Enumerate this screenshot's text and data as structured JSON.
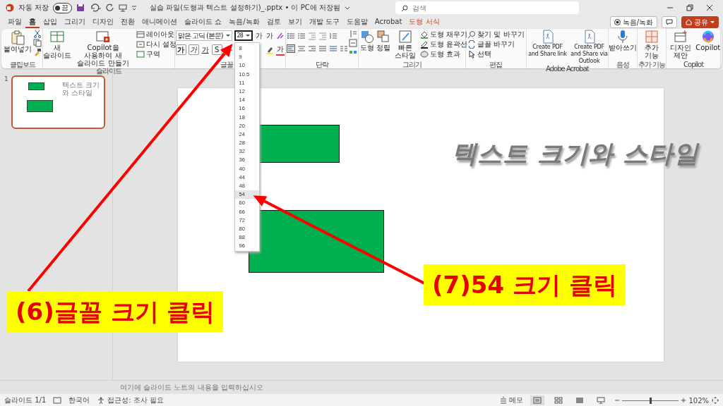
{
  "title_bar": {
    "autosave_label": "자동 저장",
    "autosave_toggle": {
      "label": "끔",
      "on": false
    },
    "document_title": "실습 파일(도형과 텍스트 설정하기)_.pptx • 이 PC에 저장됨",
    "search": {
      "placeholder": "검색"
    }
  },
  "tabs": [
    {
      "label": "파일",
      "kind": "normal",
      "selected": false
    },
    {
      "label": "홈",
      "kind": "normal",
      "selected": true
    },
    {
      "label": "삽입",
      "kind": "normal",
      "selected": false
    },
    {
      "label": "그리기",
      "kind": "normal",
      "selected": false
    },
    {
      "label": "디자인",
      "kind": "normal",
      "selected": false
    },
    {
      "label": "전환",
      "kind": "normal",
      "selected": false
    },
    {
      "label": "애니메이션",
      "kind": "normal",
      "selected": false
    },
    {
      "label": "슬라이드 쇼",
      "kind": "normal",
      "selected": false
    },
    {
      "label": "녹음/녹화",
      "kind": "normal",
      "selected": false
    },
    {
      "label": "검토",
      "kind": "normal",
      "selected": false
    },
    {
      "label": "보기",
      "kind": "normal",
      "selected": false
    },
    {
      "label": "개발 도구",
      "kind": "normal",
      "selected": false
    },
    {
      "label": "도움말",
      "kind": "normal",
      "selected": false
    },
    {
      "label": "Acrobat",
      "kind": "normal",
      "selected": false
    },
    {
      "label": "도형 서식",
      "kind": "contextual",
      "selected": false
    }
  ],
  "header_buttons": [
    {
      "kind": "record",
      "label": "녹음/녹화"
    },
    {
      "kind": "comment"
    },
    {
      "kind": "share",
      "label": "공유"
    }
  ],
  "ribbon": {
    "groups": [
      {
        "kind": "clipboard",
        "label": "클립보드",
        "paste": "붙여넣기"
      },
      {
        "kind": "slides",
        "label": "슬라이드",
        "large": [
          "새 슬라이드",
          "Copilot을 사용하여 새 슬라이드 만들기"
        ],
        "small": [
          "레이아웃",
          "다시 설정",
          "구역"
        ]
      },
      {
        "kind": "font",
        "label": "글꼴",
        "font_name": "맑은 고딕 (본문)",
        "font_size": "28",
        "grow": "가",
        "shrink": "가",
        "bold": "가",
        "italic": "가",
        "underline": "가",
        "shadow": "S",
        "font_color": "가"
      },
      {
        "kind": "paragraph",
        "label": "단락"
      },
      {
        "kind": "drawing",
        "label": "그리기",
        "large": [
          "도형",
          "정렬",
          "빠른 스타일"
        ],
        "small": [
          "도형 채우기",
          "도형 윤곽선",
          "도형 효과"
        ]
      },
      {
        "kind": "editing",
        "label": "편집",
        "small": [
          "찾기 및 바꾸기",
          "글꼴 바꾸기",
          "선택"
        ]
      },
      {
        "kind": "acrobat",
        "label": "Adobe Acrobat",
        "large": [
          "Create PDF and Share link",
          "Create PDF and Share via Outlook"
        ]
      },
      {
        "kind": "voice",
        "label": "음성",
        "large": [
          "받아쓰기"
        ]
      },
      {
        "kind": "addins",
        "label": "추가 기능",
        "large": [
          "추가 기능"
        ]
      },
      {
        "kind": "copilot",
        "label": "Copilot",
        "large": [
          "디자인 제안",
          "Copilot"
        ]
      }
    ]
  },
  "size_dropdown": {
    "options": [
      {
        "label": "8",
        "highlighted": false
      },
      {
        "label": "9",
        "highlighted": false
      },
      {
        "label": "10",
        "highlighted": false
      },
      {
        "label": "10.5",
        "highlighted": false
      },
      {
        "label": "11",
        "highlighted": false
      },
      {
        "label": "12",
        "highlighted": false
      },
      {
        "label": "14",
        "highlighted": false
      },
      {
        "label": "16",
        "highlighted": false
      },
      {
        "label": "18",
        "highlighted": false
      },
      {
        "label": "20",
        "highlighted": false
      },
      {
        "label": "24",
        "highlighted": false
      },
      {
        "label": "28",
        "highlighted": false
      },
      {
        "label": "32",
        "highlighted": false
      },
      {
        "label": "36",
        "highlighted": false
      },
      {
        "label": "40",
        "highlighted": false
      },
      {
        "label": "44",
        "highlighted": false
      },
      {
        "label": "48",
        "highlighted": false
      },
      {
        "label": "54",
        "highlighted": true
      },
      {
        "label": "60",
        "highlighted": false
      },
      {
        "label": "66",
        "highlighted": false
      },
      {
        "label": "72",
        "highlighted": false
      },
      {
        "label": "80",
        "highlighted": false
      },
      {
        "label": "88",
        "highlighted": false
      },
      {
        "label": "96",
        "highlighted": false
      }
    ]
  },
  "thumbnails": [
    {
      "number": "1",
      "selected": true,
      "title": "텍스트 크기와 스타일"
    }
  ],
  "slide": {
    "shapes": [
      {
        "kind": "rectangle"
      },
      {
        "kind": "rectangle"
      }
    ],
    "title": "텍스트 크기와 스타일"
  },
  "notes": {
    "placeholder": "여기에 슬라이드 노트의 내용을 입력하십시오"
  },
  "status_bar": {
    "slide_info": "슬라이드 1/1",
    "language": "한국어",
    "accessibility": "접근성: 조사 필요",
    "notes_button": "메모",
    "views": [
      {
        "kind": "normal",
        "selected": true
      },
      {
        "kind": "sorter",
        "selected": false
      },
      {
        "kind": "reading",
        "selected": false
      },
      {
        "kind": "slideshow",
        "selected": false
      }
    ],
    "zoom": {
      "level": 0.5,
      "reading": "102%"
    }
  },
  "annotations": [
    {
      "text": "(6)글꼴 크기 클릭"
    },
    {
      "text": "(7)54 크기 클릭"
    }
  ]
}
